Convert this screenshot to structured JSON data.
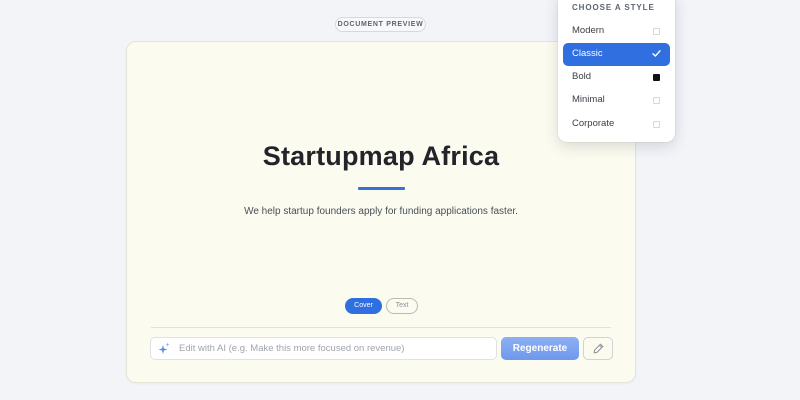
{
  "header": {
    "fragment": "",
    "preview_label": "DOCUMENT PREVIEW"
  },
  "document": {
    "title": "Startupmap Africa",
    "subtitle": "We help startup founders apply for funding applications faster."
  },
  "tabs": [
    {
      "label": "Cover",
      "active": true
    },
    {
      "label": "Text",
      "active": false
    }
  ],
  "ai_edit": {
    "placeholder": "Edit with AI (e.g. Make this more focused on revenue)",
    "value": "",
    "regenerate_label": "Regenerate"
  },
  "style_menu": {
    "heading": "CHOOSE A STYLE",
    "items": [
      {
        "label": "Modern",
        "indicator": "empty-square"
      },
      {
        "label": "Classic",
        "indicator": "checkmark",
        "selected": true
      },
      {
        "label": "Bold",
        "indicator": "filled-square"
      },
      {
        "label": "Minimal",
        "indicator": "empty-square"
      },
      {
        "label": "Corporate",
        "indicator": "empty-square"
      }
    ]
  },
  "colors": {
    "accent": "#2f6fe0",
    "card_background": "#fcfbef",
    "page_background": "#f2f4f8",
    "regenerate_button": "#7aa2ef"
  }
}
